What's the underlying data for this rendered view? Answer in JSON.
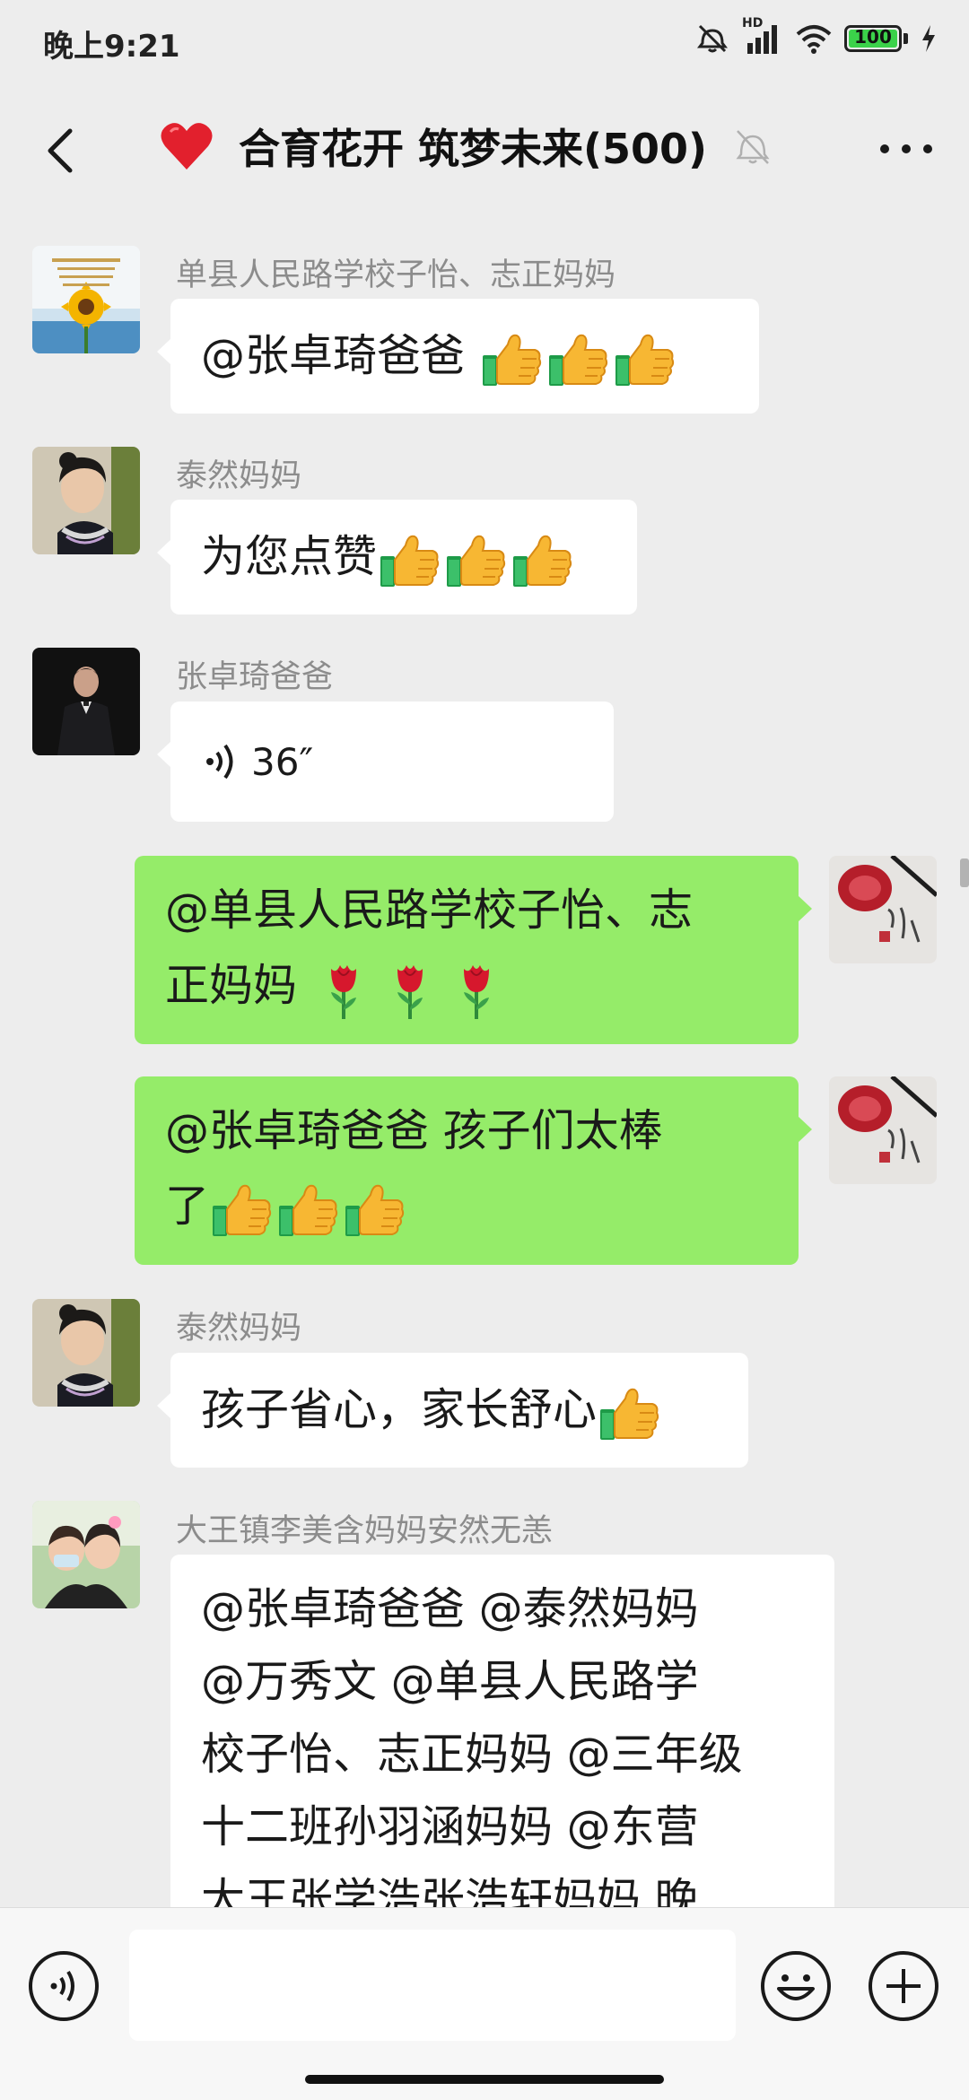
{
  "status_bar": {
    "time": "晚上9:21",
    "network_label": "HD",
    "battery": "100",
    "icons": [
      "mute-alarm-icon",
      "signal-icon",
      "wifi-icon",
      "battery-icon",
      "charging-icon"
    ]
  },
  "header": {
    "title": "合育花开 筑梦未来(500)",
    "icons": [
      "back-icon",
      "heart-icon",
      "mute-bell-icon",
      "more-icon"
    ]
  },
  "messages": [
    {
      "sender": "单县人民路学校子怡、志正妈妈",
      "side": "left",
      "text": "@张卓琦爸爸 ",
      "emoji_count": 3,
      "emoji": "thumbs-up"
    },
    {
      "sender": "泰然妈妈",
      "side": "left",
      "text": "为您点赞",
      "emoji_count": 3,
      "emoji": "thumbs-up"
    },
    {
      "sender": "张卓琦爸爸",
      "side": "left",
      "type": "voice",
      "duration": "36″"
    },
    {
      "side": "right",
      "line1": "@单县人民路学校子怡、志",
      "line2": "正妈妈 ",
      "emoji_count": 3,
      "emoji": "rose"
    },
    {
      "side": "right",
      "line1": "@张卓琦爸爸  孩子们太棒",
      "line2": "了",
      "emoji_count": 3,
      "emoji": "thumbs-up"
    },
    {
      "sender": "泰然妈妈",
      "side": "left",
      "text": "孩子省心，家长舒心",
      "emoji_count": 1,
      "emoji": "thumbs-up"
    },
    {
      "sender": "大王镇李美含妈妈安然无恙",
      "side": "left",
      "lines": [
        "@张卓琦爸爸 @泰然妈妈",
        "@万秀文 @单县人民路学",
        "校子怡、志正妈妈 @三年级",
        "十二班孙羽涵妈妈 @东营",
        "大王张学浩张浩轩妈妈 晚"
      ]
    }
  ],
  "input_bar": {
    "placeholder": "",
    "icons": [
      "voice-input-icon",
      "emoji-icon",
      "plus-icon"
    ]
  },
  "colors": {
    "background": "#ededed",
    "bubble_left": "#ffffff",
    "bubble_right": "#95ec69",
    "battery": "#3bd24a"
  }
}
